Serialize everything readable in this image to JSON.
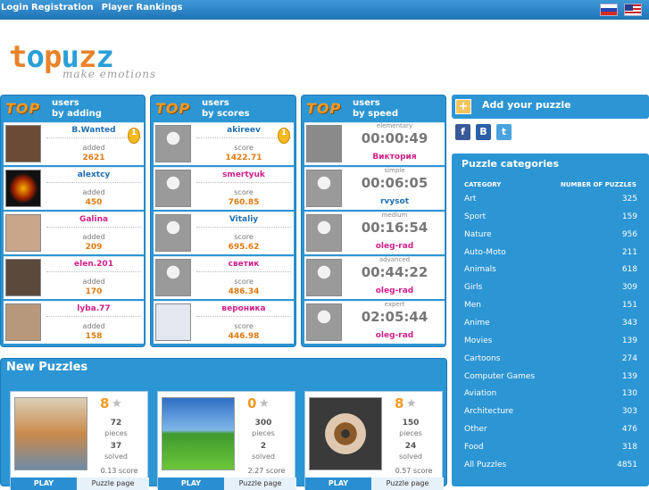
{
  "topbar": {
    "login": "Login",
    "registration": "Registration",
    "rankings": "Player Rankings"
  },
  "logo": {
    "word": "topuzz",
    "tagline": "make emotions"
  },
  "panels": [
    {
      "top": "TOP",
      "title1": "users",
      "title2": "by adding",
      "rows": [
        {
          "name": "B.Wanted",
          "label": "added",
          "value": "2621",
          "medal": true
        },
        {
          "name": "alextcy",
          "label": "added",
          "value": "450"
        },
        {
          "name": "Galina",
          "label": "added",
          "value": "209"
        },
        {
          "name": "elen.201",
          "label": "added",
          "value": "170"
        },
        {
          "name": "lyba.77",
          "label": "added",
          "value": "158"
        }
      ]
    },
    {
      "top": "TOP",
      "title1": "users",
      "title2": "by scores",
      "rows": [
        {
          "name": "akireev",
          "label": "score",
          "value": "1422.71",
          "medal": true
        },
        {
          "name": "smertyuk",
          "label": "score",
          "value": "760.85"
        },
        {
          "name": "Vitaliy",
          "label": "score",
          "value": "695.62"
        },
        {
          "name": "светик",
          "label": "score",
          "value": "486.34"
        },
        {
          "name": "вероника",
          "label": "score",
          "value": "446.98"
        }
      ]
    },
    {
      "top": "TOP",
      "title1": "users",
      "title2": "by speed",
      "rows": [
        {
          "level": "elementary",
          "time": "00:00:49",
          "name": "Виктория"
        },
        {
          "level": "simple",
          "time": "00:06:05",
          "name": "rvysot"
        },
        {
          "level": "medium",
          "time": "00:16:54",
          "name": "oleg-rad"
        },
        {
          "level": "advanced",
          "time": "00:44:22",
          "name": "oleg-rad"
        },
        {
          "level": "expert",
          "time": "02:05:44",
          "name": "oleg-rad"
        }
      ]
    }
  ],
  "new_puzzles": {
    "title": "New Puzzles",
    "cards": [
      {
        "rating": "8",
        "pieces": "72",
        "pieces_label": "pieces",
        "solved": "37",
        "solved_label": "solved",
        "score": "0.13 score",
        "play": "PLAY",
        "page": "Puzzle page"
      },
      {
        "rating": "0",
        "pieces": "300",
        "pieces_label": "pieces",
        "solved": "2",
        "solved_label": "solved",
        "score": "2.27 score",
        "play": "PLAY",
        "page": "Puzzle page"
      },
      {
        "rating": "8",
        "pieces": "150",
        "pieces_label": "pieces",
        "solved": "24",
        "solved_label": "solved",
        "score": "0.57 score",
        "play": "PLAY",
        "page": "Puzzle page"
      }
    ]
  },
  "add": {
    "title": "Add your puzzle"
  },
  "social": [
    "f",
    "B",
    "t"
  ],
  "categories": {
    "title": "Puzzle categories",
    "h1": "CATEGORY",
    "h2": "NUMBER OF PUZZLES",
    "rows": [
      {
        "n": "Art",
        "c": "325"
      },
      {
        "n": "Sport",
        "c": "159"
      },
      {
        "n": "Nature",
        "c": "956"
      },
      {
        "n": "Auto-Moto",
        "c": "211"
      },
      {
        "n": "Animals",
        "c": "618"
      },
      {
        "n": "Girls",
        "c": "309"
      },
      {
        "n": "Men",
        "c": "151"
      },
      {
        "n": "Anime",
        "c": "343"
      },
      {
        "n": "Movies",
        "c": "139"
      },
      {
        "n": "Cartoons",
        "c": "274"
      },
      {
        "n": "Computer Games",
        "c": "139"
      },
      {
        "n": "Aviation",
        "c": "130"
      },
      {
        "n": "Architecture",
        "c": "303"
      },
      {
        "n": "Other",
        "c": "476"
      },
      {
        "n": "Food",
        "c": "318"
      },
      {
        "n": "All Puzzles",
        "c": "4851"
      }
    ]
  }
}
